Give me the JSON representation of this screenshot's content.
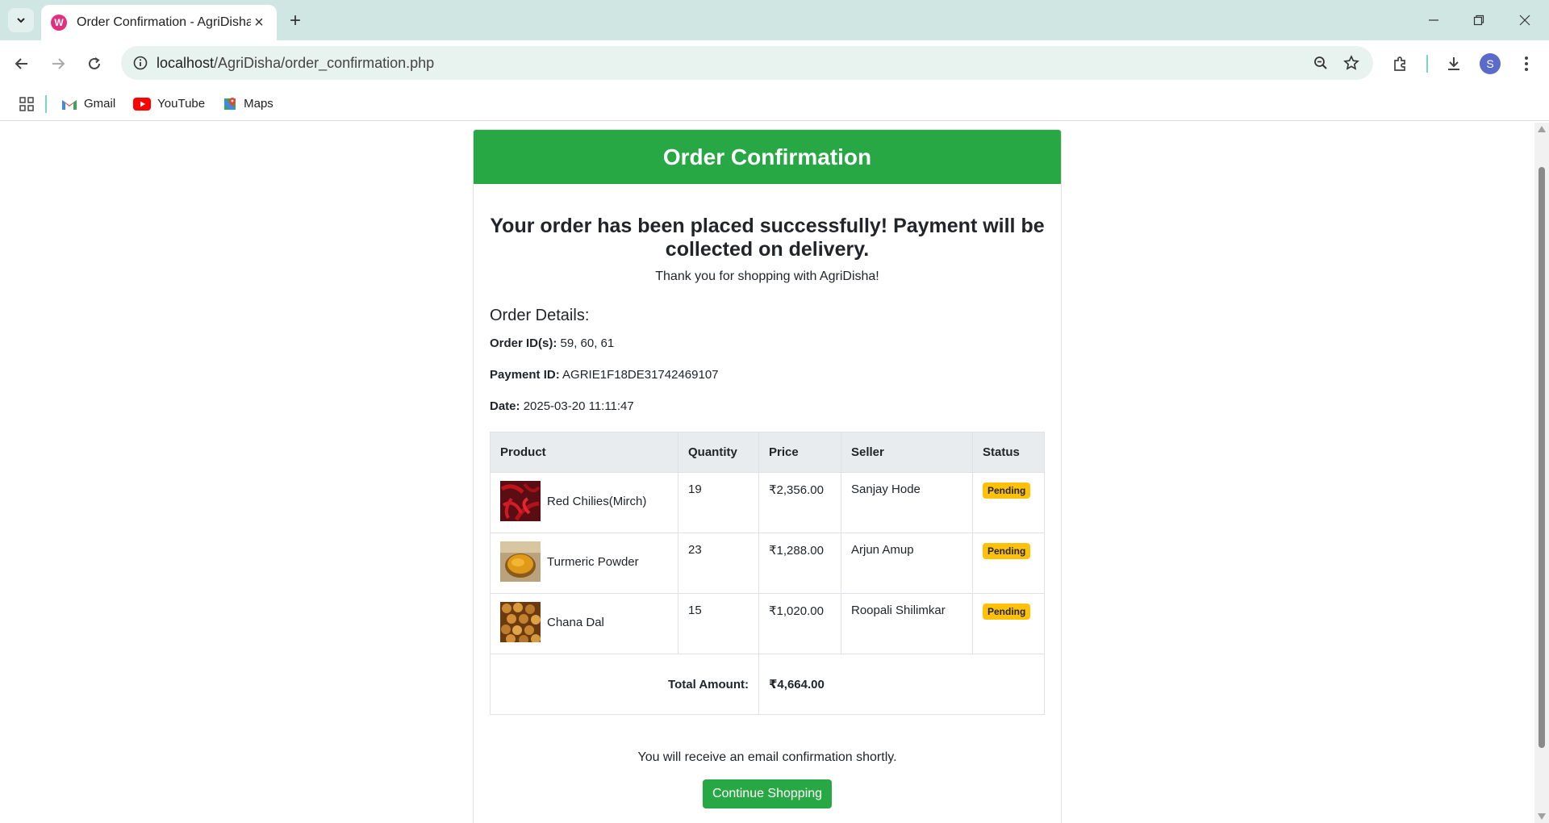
{
  "browser": {
    "tab_title": "Order Confirmation - AgriDisha",
    "url_host": "localhost",
    "url_path": "/AgriDisha/order_confirmation.php",
    "avatar_letter": "S",
    "bookmarks": [
      {
        "label": "Gmail",
        "icon": "gmail-icon"
      },
      {
        "label": "YouTube",
        "icon": "youtube-icon"
      },
      {
        "label": "Maps",
        "icon": "maps-icon"
      }
    ]
  },
  "page": {
    "header": "Order Confirmation",
    "success_message": "Your order has been placed successfully! Payment will be collected on delivery.",
    "thanks": "Thank you for shopping with AgriDisha!",
    "details_title": "Order Details:",
    "order_ids_label": "Order ID(s):",
    "order_ids": "59, 60, 61",
    "payment_id_label": "Payment ID:",
    "payment_id": "AGRIE1F18DE31742469107",
    "date_label": "Date:",
    "date": "2025-03-20 11:11:47",
    "table": {
      "headers": [
        "Product",
        "Quantity",
        "Price",
        "Seller",
        "Status"
      ],
      "rows": [
        {
          "product": "Red Chilies(Mirch)",
          "quantity": "19",
          "price": "₹2,356.00",
          "seller": "Sanjay Hode",
          "status": "Pending"
        },
        {
          "product": "Turmeric Powder",
          "quantity": "23",
          "price": "₹1,288.00",
          "seller": "Arjun Amup",
          "status": "Pending"
        },
        {
          "product": "Chana Dal",
          "quantity": "15",
          "price": "₹1,020.00",
          "seller": "Roopali Shilimkar",
          "status": "Pending"
        }
      ],
      "total_label": "Total Amount:",
      "total_value": "₹4,664.00"
    },
    "email_note": "You will receive an email confirmation shortly.",
    "cta_label": "Continue Shopping"
  },
  "colors": {
    "brand_green": "#28a745",
    "badge_yellow": "#ffc107"
  }
}
